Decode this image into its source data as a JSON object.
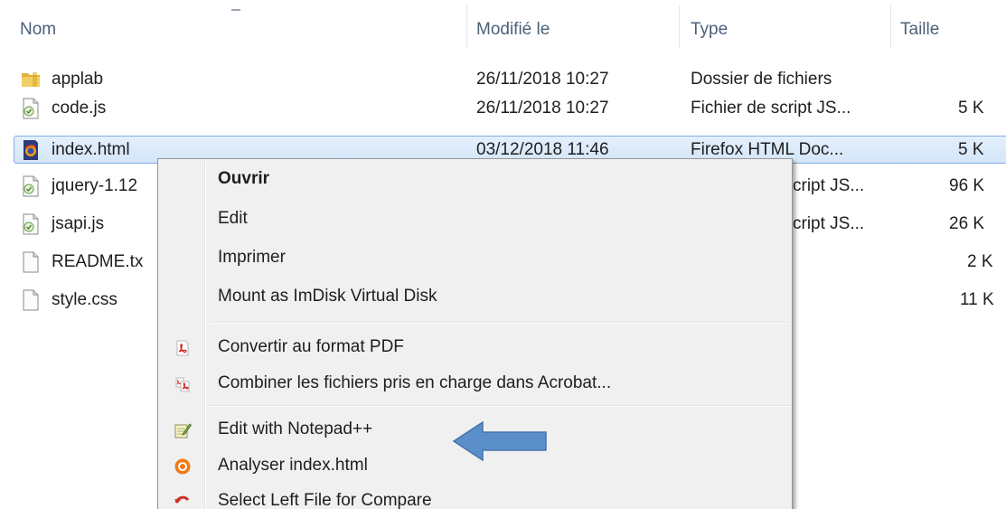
{
  "columns": {
    "name": "Nom",
    "modified": "Modifié le",
    "type": "Type",
    "size": "Taille"
  },
  "files": [
    {
      "name": "applab",
      "date": "26/11/2018 10:27",
      "type": "Dossier de fichiers",
      "size": "",
      "icon": "folder-icon"
    },
    {
      "name": "code.js",
      "date": "26/11/2018 10:27",
      "type": "Fichier de script JS...",
      "size": "5 K",
      "icon": "js-file-icon"
    },
    {
      "name": "index.html",
      "date": "03/12/2018 11:46",
      "type": "Firefox HTML Doc...",
      "size": "5 K",
      "icon": "firefox-html-icon",
      "selected": true
    },
    {
      "name": "jquery-1.12",
      "date": "",
      "type": "cript JS...",
      "size": "96 K",
      "icon": "js-file-icon"
    },
    {
      "name": "jsapi.js",
      "date": "",
      "type": "cript JS...",
      "size": "26 K",
      "icon": "js-file-icon"
    },
    {
      "name": "README.tx",
      "date": "",
      "type": "",
      "size": "2 K",
      "icon": "text-file-icon"
    },
    {
      "name": "style.css",
      "date": "",
      "type": "",
      "size": "11 K",
      "icon": "text-file-icon"
    }
  ],
  "context_menu": {
    "items": [
      {
        "label": "Ouvrir",
        "bold": true,
        "icon": ""
      },
      {
        "label": "Edit",
        "icon": ""
      },
      {
        "label": "Imprimer",
        "icon": ""
      },
      {
        "label": "Mount as ImDisk Virtual Disk",
        "icon": ""
      },
      {
        "label": "Convertir au format PDF",
        "icon": "pdf-icon"
      },
      {
        "label": "Combiner les fichiers pris en charge dans Acrobat...",
        "icon": "acrobat-combine-icon"
      },
      {
        "label": "Edit with Notepad++",
        "icon": "notepad-plus-plus-icon"
      },
      {
        "label": "Analyser index.html",
        "icon": "avast-scan-icon"
      },
      {
        "label": "Select Left File for Compare",
        "icon": "compare-icon"
      }
    ]
  },
  "colors": {
    "selection_border": "#84acdd",
    "selection_fill": "#d4e6fa",
    "arrow": "#5b8fc9",
    "header_text": "#4c607a"
  }
}
